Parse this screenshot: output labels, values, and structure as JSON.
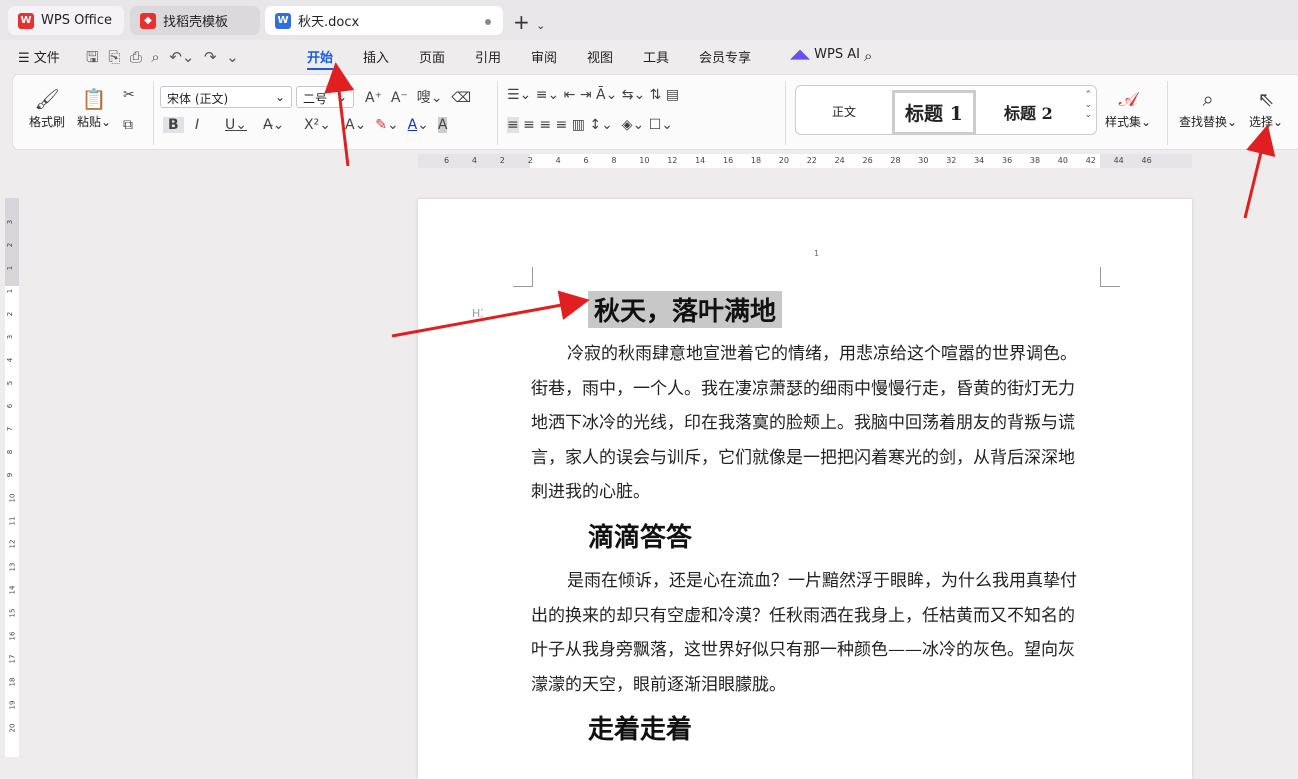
{
  "tabs": [
    {
      "label": "WPS Office",
      "color": "#e8312f"
    },
    {
      "label": "找稻壳模板",
      "color": "#e8312f"
    },
    {
      "label": "秋天.docx",
      "color": "#2f6fe0"
    }
  ],
  "menu": {
    "file": "文件",
    "items": [
      "开始",
      "插入",
      "页面",
      "引用",
      "审阅",
      "视图",
      "工具",
      "会员专享"
    ],
    "ai": "WPS AI"
  },
  "ribbon": {
    "format_painter": "格式刷",
    "paste": "粘贴",
    "font": "宋体 (正文)",
    "size": "二号",
    "bold": "B",
    "italic": "I",
    "underline": "U",
    "superscript": "X²",
    "style_normal": "正文",
    "style_h1": "标题 1",
    "style_h2": "标题 2",
    "style_set": "样式集",
    "find_replace": "查找替换",
    "select": "选择"
  },
  "ruler": [
    "6",
    "4",
    "2",
    "2",
    "4",
    "6",
    "8",
    "10",
    "12",
    "14",
    "16",
    "18",
    "20",
    "22",
    "24",
    "26",
    "28",
    "30",
    "32",
    "34",
    "36",
    "38",
    "40",
    "42",
    "44",
    "46"
  ],
  "vruler": [
    "3",
    "2",
    "1",
    "1",
    "2",
    "3",
    "4",
    "5",
    "6",
    "7",
    "8",
    "9",
    "10",
    "11",
    "12",
    "13",
    "14",
    "15",
    "16",
    "17",
    "18",
    "19",
    "20"
  ],
  "doc": {
    "page_number": "1",
    "h1": "秋天，落叶满地",
    "p1": [
      "冷寂的秋雨肆意地宣泄着它的情绪，用悲凉给这个喧嚣的世界调色。",
      "街巷，雨中，一个人。我在凄凉萧瑟的细雨中慢慢行走，昏黄的街灯无力",
      "地洒下冰冷的光线，印在我落寞的脸颊上。我脑中回荡着朋友的背叛与谎",
      "言，家人的误会与训斥，它们就像是一把把闪着寒光的剑，从背后深深地",
      "刺进我的心脏。"
    ],
    "h2": "滴滴答答",
    "p2": [
      "是雨在倾诉，还是心在流血？一片黯然浮于眼眸，为什么我用真挚付",
      "出的换来的却只有空虚和冷漠？任秋雨洒在我身上，任枯黄而又不知名的",
      "叶子从我身旁飘落，这世界好似只有那一种颜色——冰冷的灰色。望向灰",
      "濛濛的天空，眼前逐渐泪眼朦胧。"
    ],
    "h3": "走着走着"
  },
  "colors": {
    "accent": "#1a5bd8",
    "arrow": "#e02020",
    "highlight": "#c8c8c8"
  }
}
